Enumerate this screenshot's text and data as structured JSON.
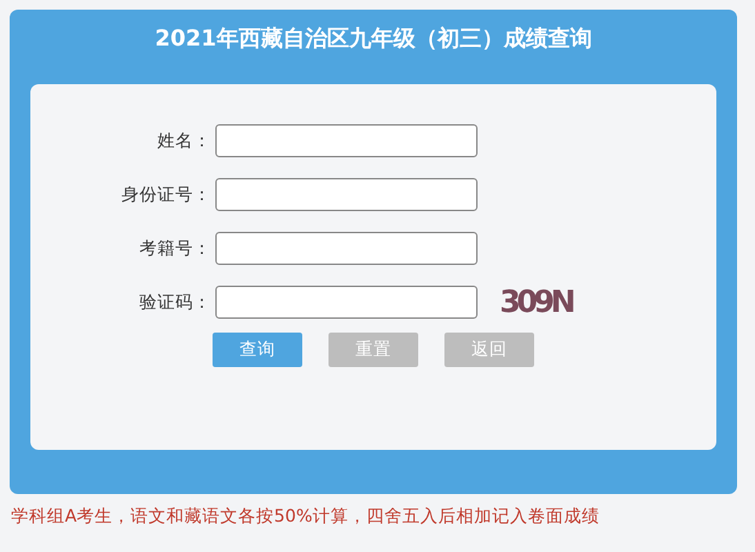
{
  "title": "2021年西藏自治区九年级（初三）成绩查询",
  "fields": [
    {
      "label": "姓名："
    },
    {
      "label": "身份证号："
    },
    {
      "label": "考籍号："
    },
    {
      "label": "验证码："
    }
  ],
  "captcha": "309N",
  "buttons": [
    {
      "label": "查询",
      "disabled": false
    },
    {
      "label": "重置",
      "disabled": true
    },
    {
      "label": "返回",
      "disabled": true
    }
  ],
  "note": "学科组A考生，语文和藏语文各按50%计算，四舍五入后相加记入卷面成绩"
}
